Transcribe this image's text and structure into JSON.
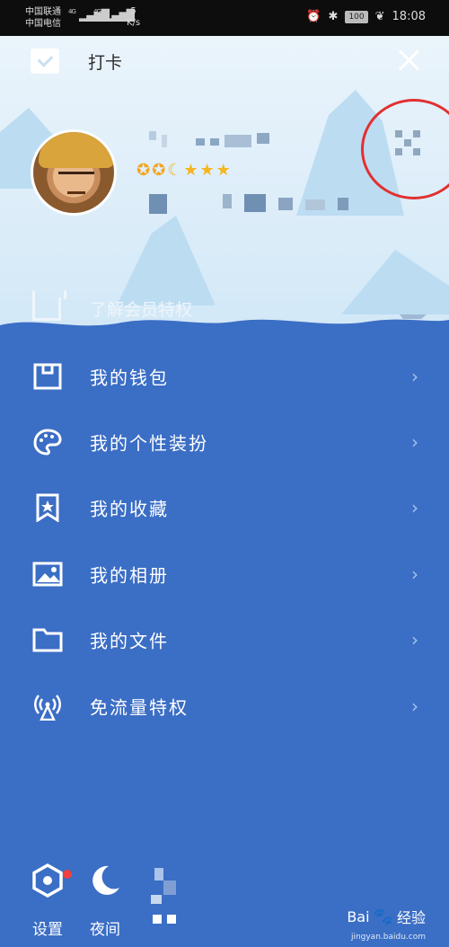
{
  "status_bar": {
    "carrier_1": "中国联通",
    "carrier_2": "中国电信",
    "net_1": "4G",
    "net_2": "4G",
    "speed_value": "5",
    "speed_unit": "K/s",
    "battery": "100",
    "time": "18:08"
  },
  "header": {
    "punch_label": "打卡",
    "vip_label": "了解会员特权"
  },
  "menu": {
    "items": [
      {
        "label": "我的钱包",
        "icon": "wallet-icon"
      },
      {
        "label": "我的个性装扮",
        "icon": "palette-icon"
      },
      {
        "label": "我的收藏",
        "icon": "bookmark-star-icon"
      },
      {
        "label": "我的相册",
        "icon": "photo-icon"
      },
      {
        "label": "我的文件",
        "icon": "folder-icon"
      },
      {
        "label": "免流量特权",
        "icon": "signal-tower-icon"
      }
    ],
    "chevron": "›"
  },
  "bottom": {
    "settings_label": "设置",
    "night_label": "夜间",
    "watermark": "Bai",
    "watermark_2": "经验",
    "watermark_url": "jingyan.baidu.com"
  },
  "colors": {
    "menu_bg": "#3b6ec5",
    "header_bg": "#e3f0fa",
    "highlight_ring": "#e23030",
    "badge_gold": "#f6b51d",
    "notify_dot": "#f04040"
  }
}
